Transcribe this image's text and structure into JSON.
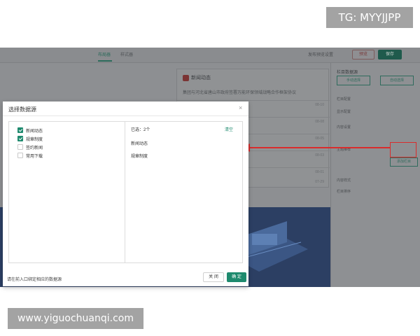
{
  "watermarks": {
    "tg": "TG: MYYJJPP",
    "url": "www.yiguochuanqi.com"
  },
  "background": {
    "tabs": [
      {
        "label": "布局器"
      },
      {
        "label": "样式器"
      }
    ],
    "toolbar": {
      "preview_settings": "发布预览设置",
      "preview_button": "预览",
      "save_button": "保存"
    },
    "card": {
      "title": "新闻动态",
      "line1": "集团与河北省唐山市政府签署万能环保领域战略合作框架协议",
      "numbers": [
        "08-10",
        "08-08",
        "08-05",
        "08-03",
        "08-01",
        "07-29"
      ]
    },
    "right_panel": {
      "title": "栏目数据源",
      "tabs": [
        "手动选择",
        "自动选择"
      ],
      "rows": [
        "栏目配置",
        "显示配置",
        "内容设置",
        "主题推荐",
        "内容样式",
        "栏目排序"
      ],
      "select_label": "添加栏目"
    }
  },
  "dialog": {
    "title": "选择数据源",
    "close_icon": "close-icon",
    "sources": [
      {
        "label": "新闻动态",
        "checked": true
      },
      {
        "label": "规章制度",
        "checked": true
      },
      {
        "label": "签约新闻",
        "checked": false
      },
      {
        "label": "常用下载",
        "checked": false
      }
    ],
    "selected_count": "已选：2个",
    "clear_label": "清空",
    "selected_items": [
      "新闻动态",
      "规章制度"
    ],
    "footer_text": "请在前入口绑定相应的数据源",
    "close_button": "关 闭",
    "ok_button": "确 定"
  },
  "colors": {
    "accent": "#1e8a6e",
    "annotation": "#d92c2c"
  }
}
